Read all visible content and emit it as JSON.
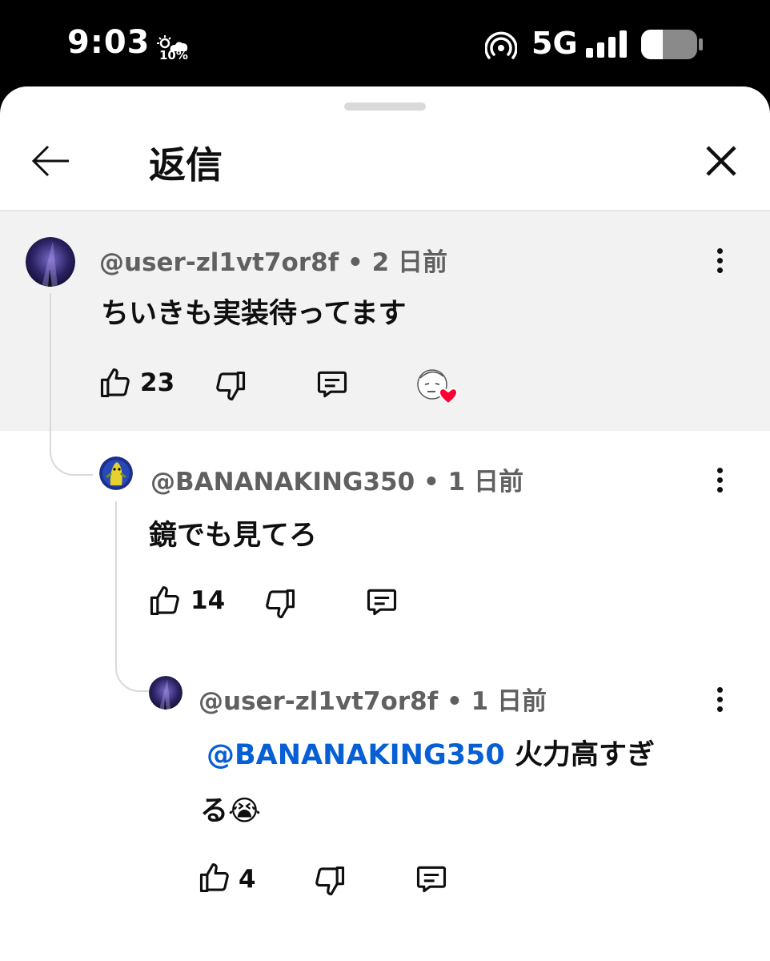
{
  "status_bar": {
    "time": "9:03",
    "weather_percent": "10%",
    "network": "5G",
    "icons": [
      "weather-icon",
      "hotspot-icon",
      "signal-icon",
      "battery-icon"
    ]
  },
  "header": {
    "title": "返信",
    "back_icon": "arrow-left-icon",
    "close_icon": "close-icon"
  },
  "parent_comment": {
    "author": "@user-zl1vt7or8f",
    "time": "2 日前",
    "text": "ちいきも実装待ってます",
    "likes": "23",
    "creator_heart": true
  },
  "replies": [
    {
      "author": "@BANANAKING350",
      "time": "1 日前",
      "text": "鏡でも見てろ",
      "likes": "14"
    },
    {
      "author": "@user-zl1vt7or8f",
      "time": "1 日前",
      "mention": "@BANANAKING350",
      "text_line1": "火力高すぎ",
      "text_line2": "る😭",
      "likes": "4"
    }
  ],
  "colors": {
    "highlight_bg": "#f2f2f2",
    "mention": "#065fd4",
    "meta": "#606060",
    "heart": "#ff0033"
  },
  "separator": "•"
}
